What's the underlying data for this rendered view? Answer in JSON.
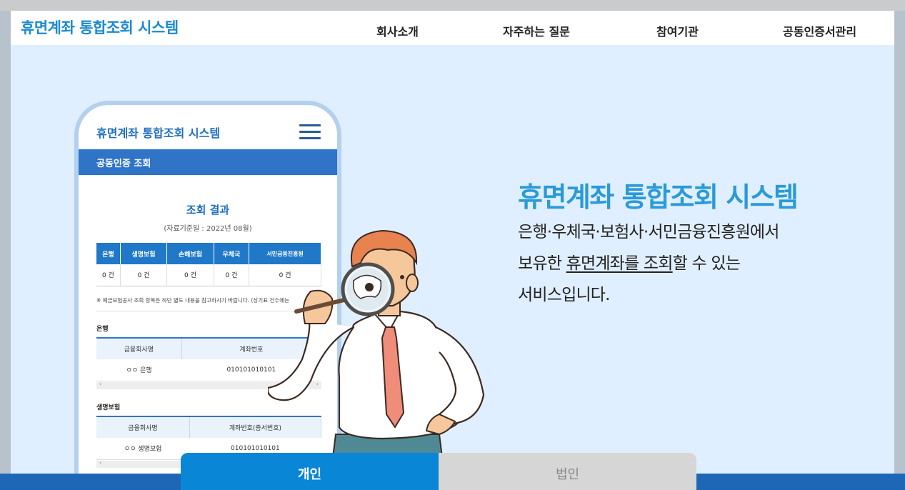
{
  "header": {
    "brand": "휴면계좌 통합조회 시스템",
    "nav": [
      "회사소개",
      "자주하는 질문",
      "참여기관",
      "공동인증서관리"
    ]
  },
  "phone": {
    "title": "휴면계좌 통합조회 시스템",
    "bar_label": "공동인증 조회",
    "result_title": "조회 결과",
    "result_date": "(자료기준일 : 2022년 08월)",
    "table_headers": [
      "은행",
      "생명보험",
      "손해보험",
      "우체국",
      "서민금융진흥원"
    ],
    "table_values": [
      "0 건",
      "0 건",
      "0 건",
      "0 건",
      "0 건"
    ],
    "note": "※ 예금보험공사 조회 항목은 하단 별도 내용을 참고하시기 바랍니다. (상기표 건수에는",
    "bank_section": "은행",
    "bank_cols": [
      "금융회사명",
      "계좌번호"
    ],
    "bank_row": [
      "ㅇㅇ 은행",
      "010101010101"
    ],
    "life_section": "생명보험",
    "life_cols": [
      "금융회사명",
      "계좌번호(증서번호)"
    ],
    "life_row": [
      "ㅇㅇ 생명보험",
      "010101010101"
    ]
  },
  "hero": {
    "title": "휴면계좌 통합조회 시스템",
    "line1": "은행·우체국·보험사·서민금융진흥원에서",
    "line2_pre": "보유한 ",
    "line2_u": "휴면계좌를 조회",
    "line2_post": "할 수 있는",
    "line3": "서비스입니다."
  },
  "tabs": {
    "personal": "개인",
    "corporate": "법인"
  },
  "colors": {
    "brand": "#1a8ad1",
    "hero_bg": "#e0efff",
    "tab_active": "#0a86d6",
    "tab_inactive": "#d6d6d6"
  }
}
